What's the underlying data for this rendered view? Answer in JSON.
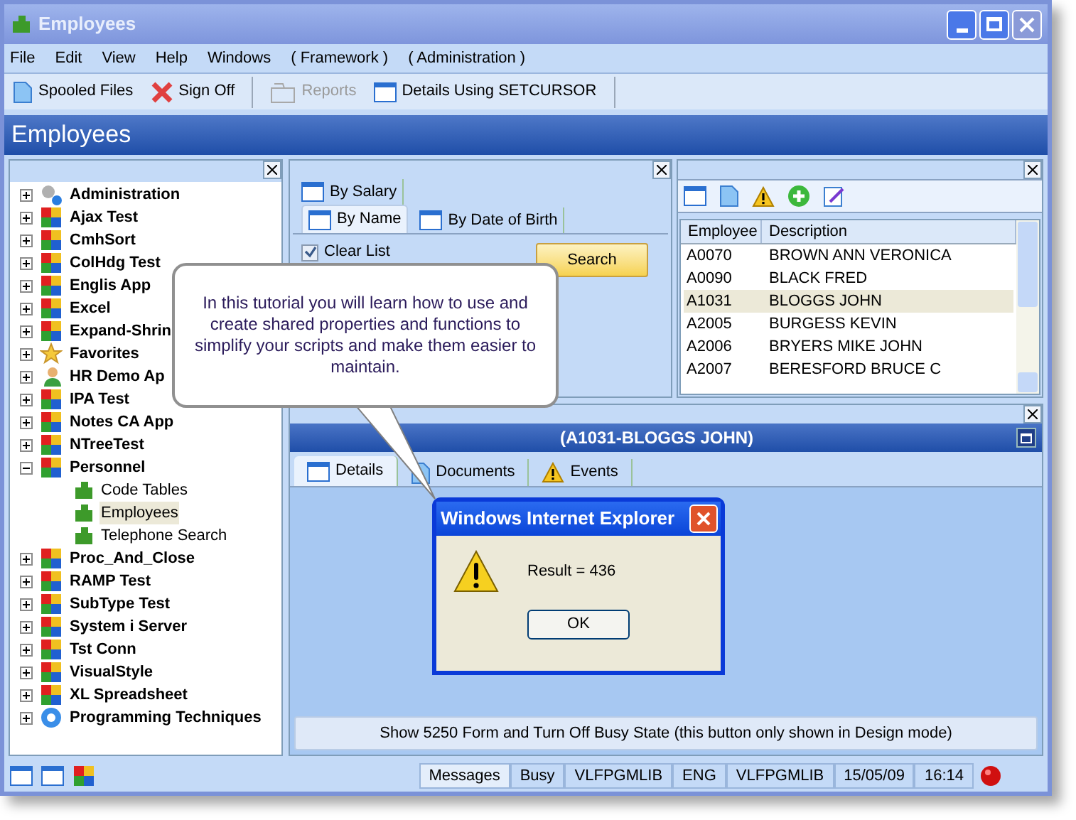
{
  "window": {
    "title": "Employees"
  },
  "menu": [
    "File",
    "Edit",
    "View",
    "Help",
    "Windows",
    "( Framework )",
    "( Administration )"
  ],
  "toolbar": [
    {
      "label": "Spooled Files",
      "kind": "document",
      "disabled": false
    },
    {
      "label": "Sign Off",
      "kind": "cross",
      "disabled": false
    },
    {
      "label": "Reports",
      "kind": "folder",
      "disabled": true
    },
    {
      "label": "Details Using SETCURSOR",
      "kind": "window",
      "disabled": false
    }
  ],
  "header": "Employees",
  "tree": [
    {
      "label": "Administration",
      "kind": "gear",
      "expanded": false,
      "selected": false
    },
    {
      "label": "Ajax Test",
      "kind": "app",
      "expanded": false,
      "selected": false
    },
    {
      "label": "CmhSort",
      "kind": "app",
      "expanded": false,
      "selected": false
    },
    {
      "label": "ColHdg Test",
      "kind": "app",
      "expanded": false,
      "selected": false
    },
    {
      "label": "Englis App",
      "kind": "app",
      "expanded": false,
      "selected": false
    },
    {
      "label": "Excel",
      "kind": "app",
      "expanded": false,
      "selected": false
    },
    {
      "label": "Expand-Shrin",
      "kind": "app",
      "expanded": false,
      "selected": false
    },
    {
      "label": "Favorites",
      "kind": "star",
      "expanded": false,
      "selected": false
    },
    {
      "label": "HR Demo Ap",
      "kind": "person",
      "expanded": false,
      "selected": false
    },
    {
      "label": "IPA Test",
      "kind": "app",
      "expanded": false,
      "selected": false
    },
    {
      "label": "Notes CA App",
      "kind": "app",
      "expanded": false,
      "selected": false
    },
    {
      "label": "NTreeTest",
      "kind": "app",
      "expanded": false,
      "selected": false
    },
    {
      "label": "Personnel",
      "kind": "app",
      "expanded": true,
      "selected": false,
      "children": [
        {
          "label": "Code Tables",
          "selected": false
        },
        {
          "label": "Employees",
          "selected": true
        },
        {
          "label": "Telephone Search",
          "selected": false
        }
      ]
    },
    {
      "label": "Proc_And_Close",
      "kind": "app",
      "expanded": false,
      "selected": false
    },
    {
      "label": "RAMP Test",
      "kind": "app",
      "expanded": false,
      "selected": false
    },
    {
      "label": "SubType Test",
      "kind": "app",
      "expanded": false,
      "selected": false
    },
    {
      "label": "System i Server",
      "kind": "app",
      "expanded": false,
      "selected": false
    },
    {
      "label": "Tst Conn",
      "kind": "app",
      "expanded": false,
      "selected": false
    },
    {
      "label": "VisualStyle",
      "kind": "app",
      "expanded": false,
      "selected": false
    },
    {
      "label": "XL Spreadsheet",
      "kind": "app",
      "expanded": false,
      "selected": false
    },
    {
      "label": "Programming Techniques",
      "kind": "cog",
      "expanded": false,
      "selected": false
    }
  ],
  "search_tabs": [
    {
      "label": "By Salary",
      "selected": false
    },
    {
      "label": "By Name",
      "selected": true
    },
    {
      "label": "By Date of Birth",
      "selected": false
    }
  ],
  "clear_list": {
    "label": "Clear List",
    "checked": true
  },
  "search_button": "Search",
  "list": {
    "columns": [
      "Employee",
      "Description"
    ],
    "rows": [
      {
        "employee": "A0070",
        "description": "BROWN ANN VERONICA",
        "selected": false
      },
      {
        "employee": "A0090",
        "description": "BLACK FRED",
        "selected": false
      },
      {
        "employee": "A1031",
        "description": "BLOGGS JOHN",
        "selected": true
      },
      {
        "employee": "A2005",
        "description": "BURGESS KEVIN",
        "selected": false
      },
      {
        "employee": "A2006",
        "description": "BRYERS MIKE JOHN",
        "selected": false
      },
      {
        "employee": "A2007",
        "description": "BERESFORD BRUCE C",
        "selected": false
      }
    ]
  },
  "detail": {
    "title": "(A1031-BLOGGS JOHN)",
    "tabs": [
      {
        "label": "Details",
        "kind": "window",
        "selected": true
      },
      {
        "label": "Documents",
        "kind": "document",
        "selected": false
      },
      {
        "label": "Events",
        "kind": "warning",
        "selected": false
      }
    ],
    "button": "Show 5250 Form and Turn Off Busy State (this button only shown in Design mode)"
  },
  "callout": "In this tutorial you will learn how to use and create shared properties and functions to simplify your scripts and make them easier to maintain.",
  "dialog": {
    "title": "Windows Internet Explorer",
    "message": "Result = 436",
    "button": "OK"
  },
  "status_bar": [
    "Messages",
    "Busy",
    "VLFPGMLIB",
    "ENG",
    "VLFPGMLIB",
    "15/05/09",
    "16:14"
  ]
}
